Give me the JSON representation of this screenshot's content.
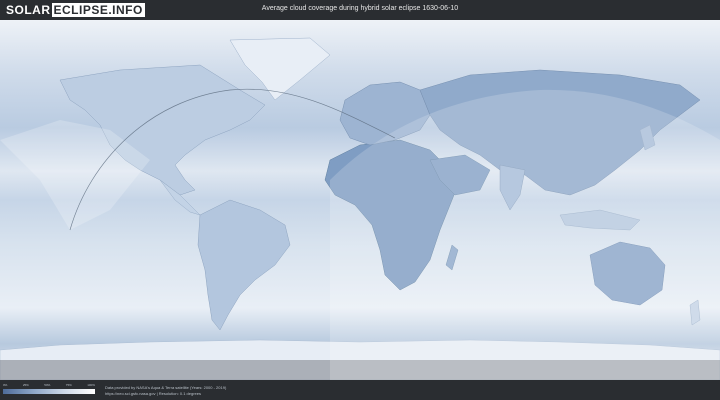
{
  "header": {
    "logo_part1": "SOLAR",
    "logo_part2": "ECLIPSE.INFO",
    "title": "Average cloud coverage during hybrid solar eclipse 1630-06-10"
  },
  "legend": {
    "ticks": [
      "0%",
      "25%",
      "50%",
      "75%",
      "100%"
    ],
    "colors": {
      "low": "#4e6c9a",
      "high": "#ffffff"
    }
  },
  "footer": {
    "credit_line1": "Data provided by NASA's Aqua & Terra satellite (Years: 2000 - 2019)",
    "credit_line2": "https://neo.sci.gsfc.nasa.gov | Resolution: 0.1 degrees"
  }
}
